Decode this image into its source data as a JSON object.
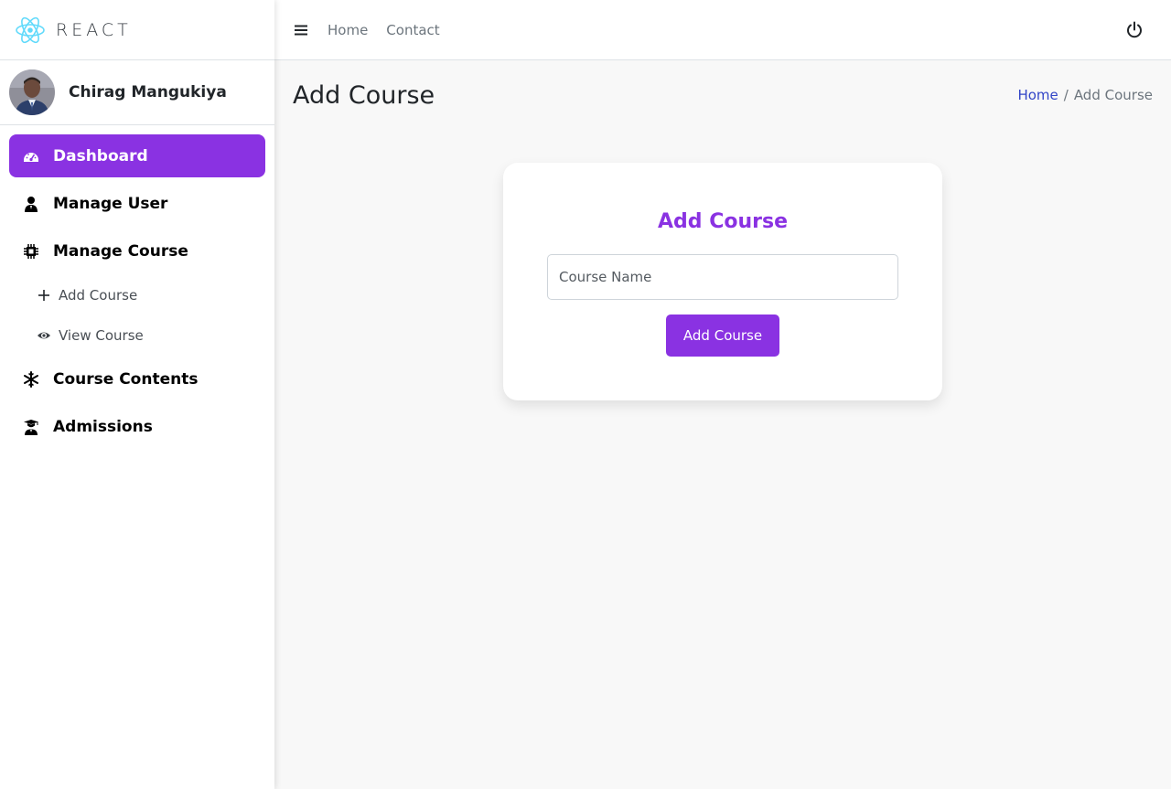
{
  "brand": {
    "name": "REACT",
    "logo_icon": "react-logo-icon",
    "logo_color": "#61dafb"
  },
  "user": {
    "name": "Chirag Mangukiya",
    "avatar_icon": "user-avatar"
  },
  "sidebar": {
    "items": [
      {
        "label": "Dashboard",
        "icon": "dashboard-gauge-icon",
        "active": true
      },
      {
        "label": "Manage User",
        "icon": "user-icon"
      },
      {
        "label": "Manage Course",
        "icon": "chip-icon"
      },
      {
        "label": "Course Contents",
        "icon": "snowflake-icon"
      },
      {
        "label": "Admissions",
        "icon": "graduate-icon"
      }
    ],
    "subitems": [
      {
        "label": "Add Course",
        "icon": "plus-icon"
      },
      {
        "label": "View Course",
        "icon": "eye-icon"
      }
    ]
  },
  "topbar": {
    "menu_icon": "hamburger-menu-icon",
    "links": [
      "Home",
      "Contact"
    ],
    "power_icon": "power-icon"
  },
  "header": {
    "title": "Add Course",
    "breadcrumb": {
      "home": "Home",
      "separator": "/",
      "current": "Add Course"
    }
  },
  "form": {
    "title": "Add Course",
    "course_name_placeholder": "Course Name",
    "course_name_value": "",
    "submit_label": "Add Course"
  },
  "colors": {
    "accent": "#8a32e2",
    "breadcrumb_link": "#3245c7",
    "page_background": "#f8f8f8"
  }
}
